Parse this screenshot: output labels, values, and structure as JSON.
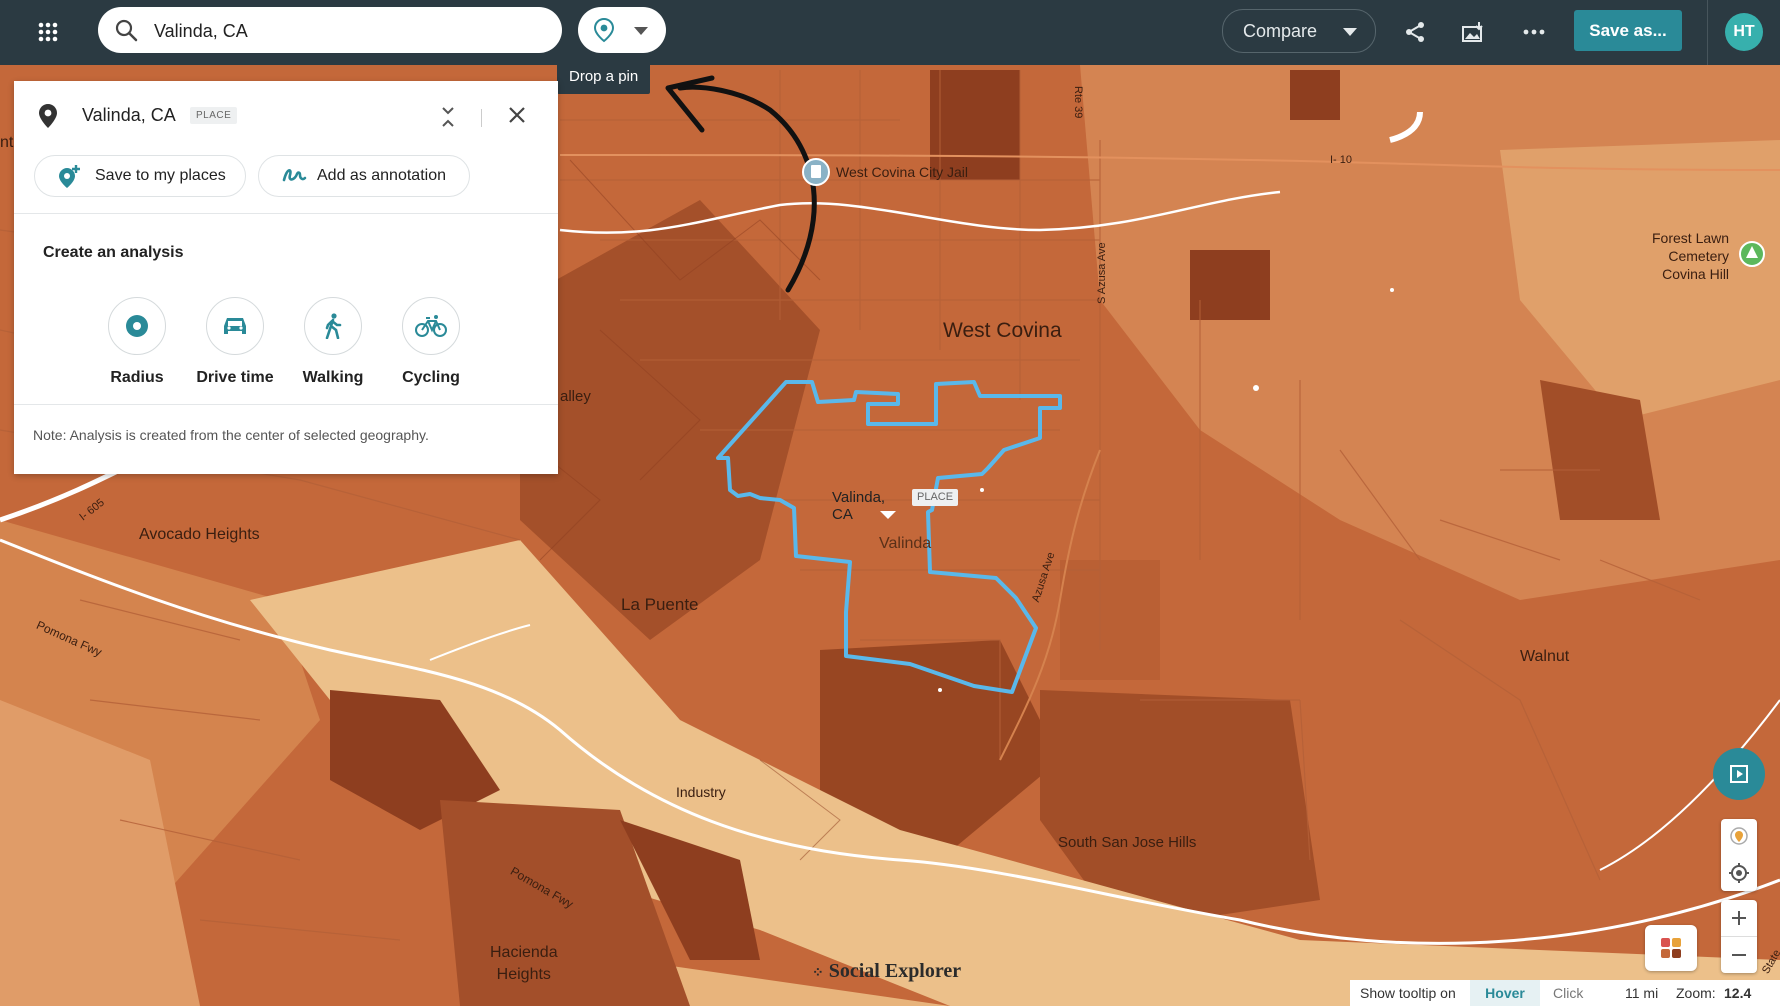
{
  "topbar": {
    "search_value": "Valinda, CA",
    "pin_tooltip": "Drop a pin",
    "compare_label": "Compare",
    "save_label": "Save as...",
    "avatar_initials": "HT",
    "icons": [
      "apps-grid-icon",
      "search-icon",
      "location-pin-icon",
      "chevron-down-icon",
      "share-icon",
      "export-image-icon",
      "more-icon"
    ]
  },
  "panel": {
    "place_name": "Valinda, CA",
    "place_type": "PLACE",
    "save_places_label": "Save to my places",
    "annotation_label": "Add as annotation",
    "analysis_heading": "Create an analysis",
    "options": [
      {
        "label": "Radius",
        "icon": "radius-icon"
      },
      {
        "label": "Drive time",
        "icon": "car-icon"
      },
      {
        "label": "Walking",
        "icon": "walking-icon"
      },
      {
        "label": "Cycling",
        "icon": "bicycle-icon"
      }
    ],
    "note": "Note: Analysis is created from the center of selected geography."
  },
  "map": {
    "selected_place_tip": "Valinda, CA",
    "selected_place_badge": "PLACE",
    "labels": {
      "west_covina": "West Covina",
      "valinda": "Valinda",
      "la_puente": "La Puente",
      "avocado_heights": "Avocado Heights",
      "walnut": "Walnut",
      "industry": "Industry",
      "hacienda_heights": "Hacienda\nHeights",
      "south_san_jose_hills": "South San Jose Hills",
      "forest_lawn": "Forest Lawn\nCemetery\nCovina Hill",
      "jail": "West Covina City Jail",
      "valley": "alley",
      "i10": "I- 10",
      "i605": "I- 605",
      "rte39": "Rte 39",
      "s_azusa": "S Azusa Ave",
      "azusa": "Azusa Ave",
      "pomona1": "Pomona Fwy",
      "pomona2": "Pomona Fwy",
      "edge_nt": "nt",
      "edge_state": "State"
    },
    "colors": {
      "light": "#ecc08a",
      "mid": "#d8884e",
      "base": "#c4683a",
      "dark": "#a4502a",
      "darker": "#8e3e1f",
      "boundary": "#5ab8ea"
    }
  },
  "footer": {
    "watermark": "Social Explorer",
    "tooltip_label": "Show tooltip on",
    "hover_label": "Hover",
    "click_label": "Click",
    "scale": "11 mi",
    "zoom_label": "Zoom:",
    "zoom_value": "12.4"
  }
}
